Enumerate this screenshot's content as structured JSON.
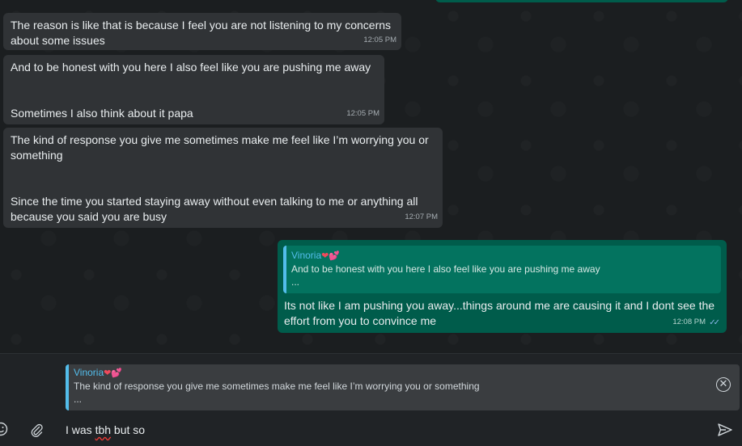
{
  "messages": [
    {
      "direction": "in",
      "text": "The reason is like that is because I feel you are not listening to my concerns\nabout some issues",
      "time": "12:05 PM"
    },
    {
      "direction": "in",
      "text": "And to be honest with you here I also feel like you are pushing me away\n\n\nSometimes I also think about it papa",
      "time": "12:05 PM"
    },
    {
      "direction": "in",
      "text": "The kind of response you give me sometimes make me feel like I’m worrying you or\nsomething\n\n\nSince the time you started staying away without even talking to me or anything all\nbecause you said you are busy",
      "time": "12:07 PM"
    },
    {
      "direction": "out",
      "quote": {
        "author": "Vinoria",
        "author_emoji": "❤️💕",
        "text": "And to be honest with you here I also feel like you are pushing me away",
        "more": "..."
      },
      "text": "Its not like I am pushing you away...things around me are causing it and I dont see the\neffort from you to convince me",
      "time": "12:08 PM",
      "status": "read"
    }
  ],
  "composer": {
    "reply_preview": {
      "author": "Vinoria",
      "author_emoji": "❤️💕",
      "text": "The kind of response you give me sometimes make me feel like I’m worrying you or something",
      "more": "..."
    },
    "input_before": "I was ",
    "input_misspelled": "tbh",
    "input_after": " but so"
  },
  "colors": {
    "incoming": "#303336",
    "outgoing": "#005c4b",
    "accent": "#53bdeb",
    "read_ticks": "#8ab7ea"
  },
  "icons": [
    "emoji-icon",
    "attach-icon",
    "send-icon",
    "close-icon",
    "double-check-icon"
  ]
}
